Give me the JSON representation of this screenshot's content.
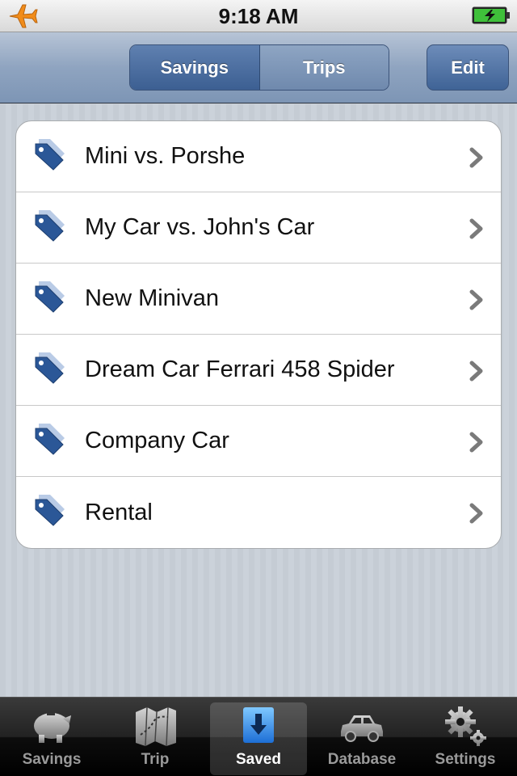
{
  "status_bar": {
    "time": "9:18 AM",
    "icons": [
      "airplane-mode-icon",
      "battery-charging-icon"
    ]
  },
  "nav_bar": {
    "segments": [
      {
        "label": "Savings",
        "selected": true
      },
      {
        "label": "Trips",
        "selected": false
      }
    ],
    "edit_label": "Edit"
  },
  "list": {
    "icon": "price-tag-icon",
    "accent_color": "#2b5797",
    "items": [
      {
        "label": "Mini vs. Porshe"
      },
      {
        "label": "My Car vs. John's Car"
      },
      {
        "label": "New Minivan"
      },
      {
        "label": "Dream Car Ferrari 458 Spider"
      },
      {
        "label": "Company Car"
      },
      {
        "label": "Rental"
      }
    ]
  },
  "tab_bar": {
    "tabs": [
      {
        "label": "Savings",
        "icon": "piggy-bank-icon",
        "selected": false
      },
      {
        "label": "Trip",
        "icon": "map-icon",
        "selected": false
      },
      {
        "label": "Saved",
        "icon": "download-icon",
        "selected": true
      },
      {
        "label": "Database",
        "icon": "car-icon",
        "selected": false
      },
      {
        "label": "Settings",
        "icon": "gear-icon",
        "selected": false
      }
    ]
  }
}
